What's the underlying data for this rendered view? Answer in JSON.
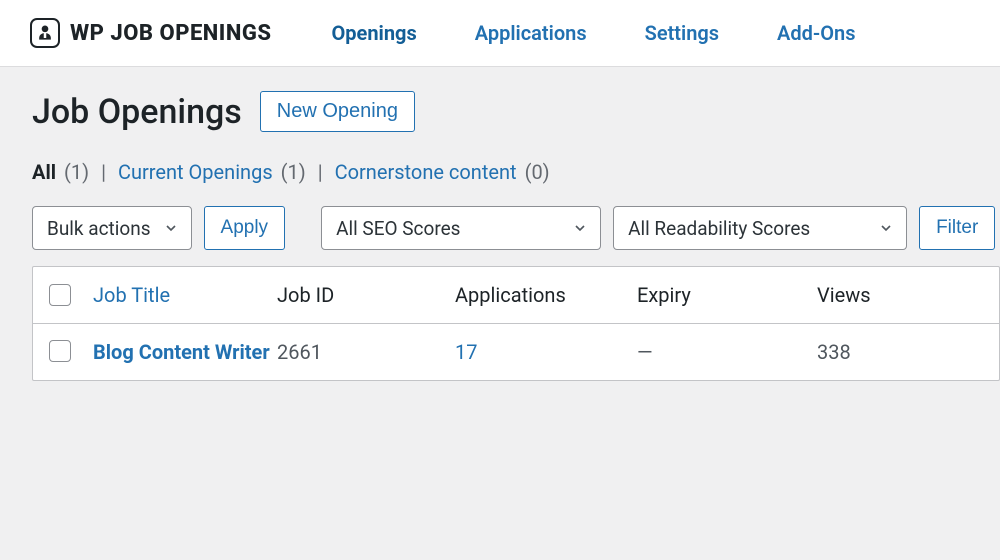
{
  "brand": "WP JOB OPENINGS",
  "nav": {
    "openings": "Openings",
    "applications": "Applications",
    "settings": "Settings",
    "addons": "Add-Ons"
  },
  "page": {
    "title": "Job Openings",
    "new_button": "New Opening"
  },
  "filters": {
    "all_label": "All",
    "all_count": "(1)",
    "current_label": "Current Openings",
    "current_count": "(1)",
    "cornerstone_label": "Cornerstone content",
    "cornerstone_count": "(0)"
  },
  "controls": {
    "bulk_actions": "Bulk actions",
    "apply": "Apply",
    "seo_scores": "All SEO Scores",
    "readability_scores": "All Readability Scores",
    "filter": "Filter"
  },
  "table": {
    "headers": {
      "job_title": "Job Title",
      "job_id": "Job ID",
      "applications": "Applications",
      "expiry": "Expiry",
      "views": "Views"
    },
    "rows": [
      {
        "title": "Blog Content Writer",
        "job_id": "2661",
        "applications": "17",
        "expiry": "—",
        "views": "338"
      }
    ]
  }
}
